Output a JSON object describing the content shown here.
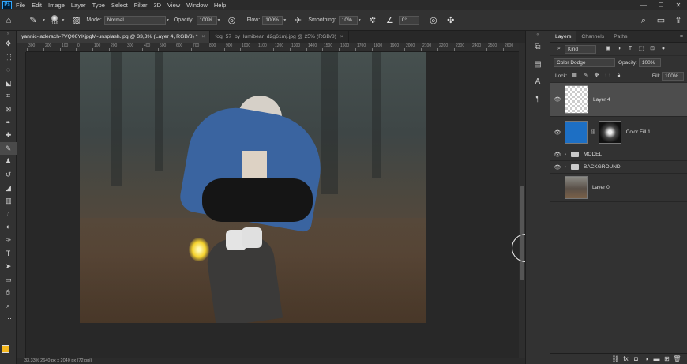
{
  "app": {
    "logo": "Ps"
  },
  "menu": [
    "File",
    "Edit",
    "Image",
    "Layer",
    "Type",
    "Select",
    "Filter",
    "3D",
    "View",
    "Window",
    "Help"
  ],
  "window_controls": [
    "—",
    "☐",
    "✕"
  ],
  "options": {
    "brush_size": "146",
    "mode_label": "Mode:",
    "mode_value": "Normal",
    "opacity_label": "Opacity:",
    "opacity_value": "100%",
    "flow_label": "Flow:",
    "flow_value": "100%",
    "smoothing_label": "Smoothing:",
    "smoothing_value": "10%",
    "angle_value": "0°"
  },
  "tabs": [
    {
      "label": "yannic-laderach-7VQ06YKjpgM-unsplash.jpg @ 33,3% (Layer 4, RGB/8) *",
      "close": "×"
    },
    {
      "label": "fog_57_by_lumibear_d2g61mj.jpg @ 25% (RGB/8)",
      "close": "×"
    }
  ],
  "ruler_ticks": [
    "300",
    "200",
    "100",
    "0",
    "100",
    "200",
    "300",
    "400",
    "500",
    "600",
    "700",
    "800",
    "900",
    "1000",
    "1100",
    "1200",
    "1300",
    "1400",
    "1500",
    "1600",
    "1700",
    "1800",
    "1900",
    "2000",
    "2100",
    "2200",
    "2300",
    "2400",
    "2500",
    "2600"
  ],
  "status": "33,33%    2640 px x 2040 px (72 ppi)",
  "panel": {
    "tabs": [
      "Layers",
      "Channels",
      "Paths"
    ],
    "menu_icon": "≡",
    "kind_value": "Kind",
    "blend_mode": "Color Dodge",
    "opacity_label": "Opacity:",
    "opacity_value": "100%",
    "lock_label": "Lock:",
    "fill_label": "Fill:",
    "fill_value": "100%"
  },
  "layers": [
    {
      "name": "Layer 4",
      "type": "layer",
      "selected": true,
      "visible": true
    },
    {
      "name": "Color Fill 1",
      "type": "fill",
      "visible": true,
      "fill_color": "#1d6fc4"
    },
    {
      "name": "MODEL",
      "type": "group",
      "visible": true
    },
    {
      "name": "BACKGROUND",
      "type": "group",
      "visible": true
    },
    {
      "name": "Layer 0",
      "type": "photo",
      "visible": false
    }
  ],
  "colors": {
    "foreground": "#f5b81e",
    "background": "#ffffff",
    "accent": "#31a8ff"
  }
}
